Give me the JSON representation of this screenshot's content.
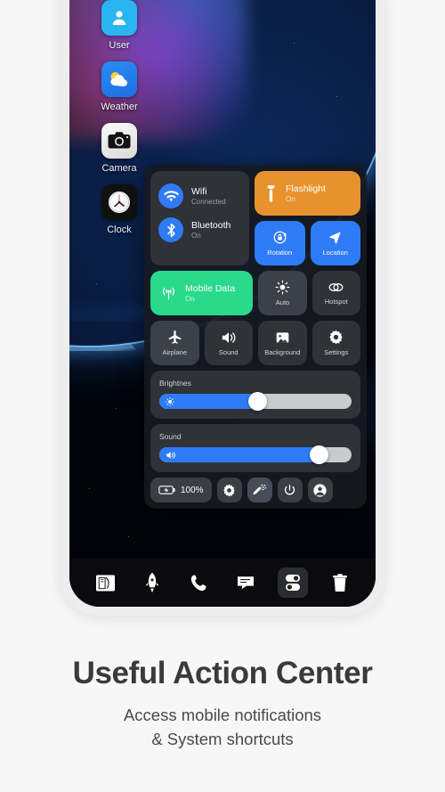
{
  "caption": {
    "headline": "Useful Action Center",
    "sub_line1": "Access mobile notifications",
    "sub_line2": "& System shortcuts"
  },
  "home_apps": [
    {
      "label": "User",
      "icon": "user-icon"
    },
    {
      "label": "Weather",
      "icon": "weather-icon"
    },
    {
      "label": "Camera",
      "icon": "camera-icon"
    },
    {
      "label": "Clock",
      "icon": "clock-icon"
    }
  ],
  "control_center": {
    "connectivity": [
      {
        "name": "Wifi",
        "status": "Connected",
        "icon": "wifi-icon",
        "color": "#2f7bf6"
      },
      {
        "name": "Bluetooth",
        "status": "On",
        "icon": "bluetooth-icon",
        "color": "#2f7bf6"
      }
    ],
    "flashlight": {
      "name": "Flashlight",
      "status": "On",
      "icon": "flashlight-icon",
      "color": "#e8922e"
    },
    "mobile_data": {
      "name": "Mobile Data",
      "status": "On",
      "icon": "signal-icon",
      "color": "#2ad98c"
    },
    "tiles": [
      {
        "label": "Rotation",
        "icon": "rotation-lock-icon",
        "active": true,
        "color": "#2f7bf6"
      },
      {
        "label": "Location",
        "icon": "location-arrow-icon",
        "active": true,
        "color": "#2f7bf6"
      },
      {
        "label": "Auto",
        "icon": "brightness-auto-icon",
        "active": false,
        "color": "#3b4049"
      },
      {
        "label": "Hotspot",
        "icon": "hotspot-icon",
        "active": false,
        "color": "#2f3238"
      },
      {
        "label": "Airplane",
        "icon": "airplane-icon",
        "active": false,
        "color": "#3b4049"
      },
      {
        "label": "Sound",
        "icon": "speaker-icon",
        "active": false,
        "color": "#2f3238"
      },
      {
        "label": "Background",
        "icon": "image-icon",
        "active": false,
        "color": "#2f3238"
      },
      {
        "label": "Settings",
        "icon": "gear-icon",
        "active": false,
        "color": "#2f3238"
      }
    ],
    "sliders": [
      {
        "label": "Brightnes",
        "value": 53,
        "icon": "brightness-icon"
      },
      {
        "label": "Sound",
        "value": 86,
        "icon": "volume-icon"
      }
    ],
    "action_bar": {
      "battery_text": "100%",
      "battery_icon": "battery-charging-icon",
      "buttons": [
        {
          "icon": "gear-icon",
          "active": false
        },
        {
          "icon": "edit-icon",
          "active": true
        },
        {
          "icon": "power-icon",
          "active": false
        },
        {
          "icon": "profile-icon",
          "active": false
        }
      ]
    }
  },
  "dock": [
    {
      "icon": "finder-icon",
      "active": false
    },
    {
      "icon": "launchpad-icon",
      "active": false
    },
    {
      "icon": "phone-icon",
      "active": false
    },
    {
      "icon": "messages-icon",
      "active": false
    },
    {
      "icon": "toggles-icon",
      "active": true
    },
    {
      "icon": "trash-icon",
      "active": false
    }
  ]
}
